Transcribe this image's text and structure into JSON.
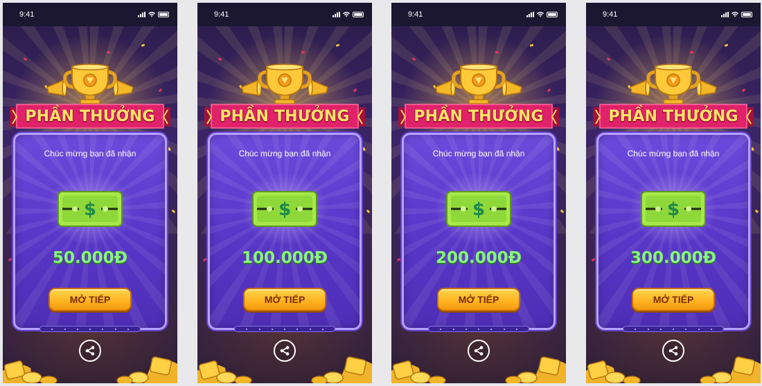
{
  "colors": {
    "background": "#e9e9ec",
    "statusbar": "#1c1730",
    "card": "#5937c8",
    "card_border": "#b7a1ff",
    "ribbon": "#e0226a",
    "ribbon_text": "#ffe26a",
    "amount": "#89f37f",
    "button": "#ffb21f",
    "button_text": "#7a2a00",
    "money": "#a6e84a"
  },
  "screens": [
    {
      "status": {
        "time": "9:41"
      },
      "title": "PHẦN THƯỞNG",
      "subtitle": "Chúc mừng bạn đã nhận",
      "money_icon": "dollar-bill-icon",
      "money_symbol": "$",
      "amount": "50.000Đ",
      "button_label": "MỞ TIẾP",
      "share_icon": "share-icon"
    },
    {
      "status": {
        "time": "9:41"
      },
      "title": "PHẦN THƯỞNG",
      "subtitle": "Chúc mừng bạn đã nhận",
      "money_icon": "dollar-bill-icon",
      "money_symbol": "$",
      "amount": "100.000Đ",
      "button_label": "MỞ TIẾP",
      "share_icon": "share-icon"
    },
    {
      "status": {
        "time": "9:41"
      },
      "title": "PHẦN THƯỞNG",
      "subtitle": "Chúc mừng bạn đã nhận",
      "money_icon": "dollar-bill-icon",
      "money_symbol": "$",
      "amount": "200.000Đ",
      "button_label": "MỞ TIẾP",
      "share_icon": "share-icon"
    },
    {
      "status": {
        "time": "9:41"
      },
      "title": "PHẦN THƯỞNG",
      "subtitle": "Chúc mừng bạn đã nhận",
      "money_icon": "dollar-bill-icon",
      "money_symbol": "$",
      "amount": "300.000Đ",
      "button_label": "MỞ TIẾP",
      "share_icon": "share-icon"
    }
  ]
}
